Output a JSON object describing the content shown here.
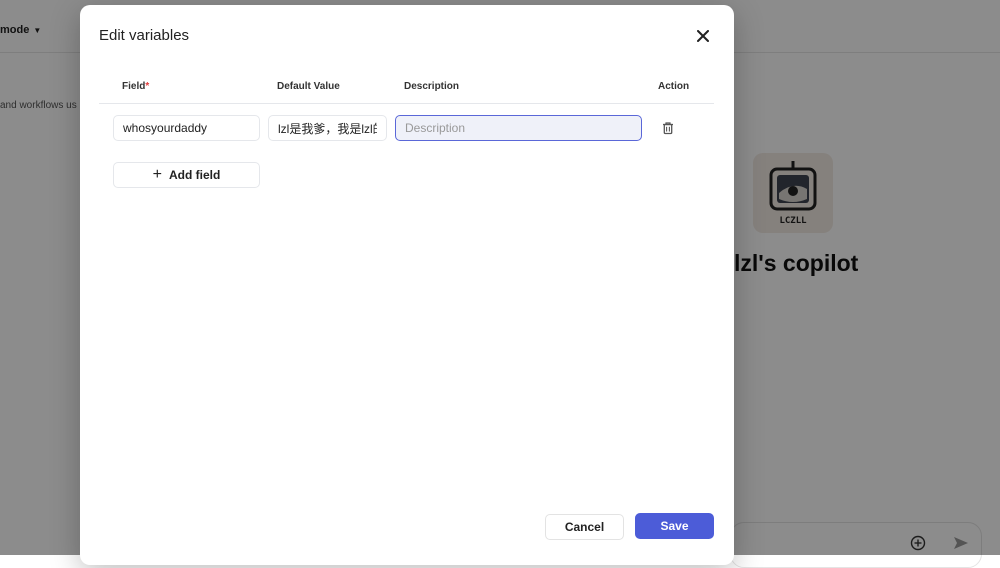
{
  "background": {
    "mode_label": "mode",
    "hint_text": "and workflows us",
    "bot_name": "lzl's copilot",
    "avatar_text": "LCZLL"
  },
  "dialog": {
    "title": "Edit variables",
    "columns": {
      "field": "Field",
      "required_mark": "*",
      "default_value": "Default Value",
      "description": "Description",
      "action": "Action"
    },
    "rows": [
      {
        "field": "whosyourdaddy",
        "default_value": "lzl是我爹，我是lzl的",
        "description": "",
        "description_placeholder": "Description"
      }
    ],
    "add_field_label": "Add field",
    "cancel_label": "Cancel",
    "save_label": "Save"
  },
  "colors": {
    "primary": "#4c5cd8",
    "required": "#e23c3c",
    "focus_border": "#5a67d8"
  },
  "icons": [
    "close-icon",
    "trash-icon",
    "plus-icon",
    "add-circle-icon",
    "send-icon",
    "caret-down-icon"
  ]
}
